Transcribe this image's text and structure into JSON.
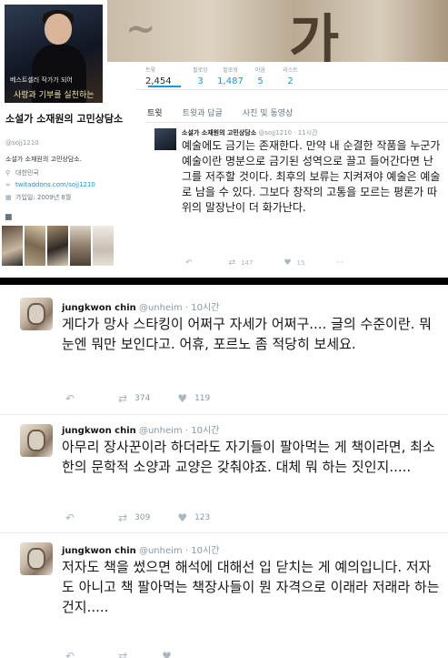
{
  "profile": {
    "banner_text": "가",
    "avatar_caption_1": "베스트셀러 작가가 되어",
    "avatar_caption_2": "사랑과 기부를 실천하는",
    "name": "소설가 소재원의 고민상담소",
    "handle": "@sojj1210",
    "bio": "소설가 소재원의 고민상담소.",
    "location": "대한민국",
    "website": "twitaddons.com/sojj1210",
    "joined": "가입일: 2009년 8월"
  },
  "stats": [
    {
      "label": "트윗",
      "value": "2,454"
    },
    {
      "label": "팔로잉",
      "value": "3"
    },
    {
      "label": "팔로워",
      "value": "1,487"
    },
    {
      "label": "마음",
      "value": "5"
    },
    {
      "label": "리스트",
      "value": "2"
    }
  ],
  "tabs": [
    "트윗",
    "트윗과 답글",
    "사진 및 동영상"
  ],
  "top_tweet": {
    "name": "소설가 소재원의 고민상담소",
    "handle": "@sojj1210",
    "time": "11시간",
    "text": "예술에도 금기는 존재한다. 만약 내 순결한 작품을 누군가 예술이란 명분으로 금기된 성역으로 끌고 들어간다면 난 그를 저주할 것이다. 최후의 보류는 지켜져야 예술은 예술로 남을 수 있다. 그보다 창작의 고통을 모르는 평론가 따위의 말장난이 더 화가난다.",
    "retweets": "147",
    "likes": "15"
  },
  "tweets": [
    {
      "name": "jungkwon chin",
      "handle": "@unheim",
      "time": "10시간",
      "text": "게다가 망사 스타킹이 어쩌구 자세가 어쩌구.... 글의 수준이란. 뭐 눈엔 뭐만 보인다고. 어휴, 포르노 좀 적당히 보세요.",
      "retweets": "374",
      "likes": "119"
    },
    {
      "name": "jungkwon chin",
      "handle": "@unheim",
      "time": "10시간",
      "text": "아무리 장사꾼이라 하더라도 자기들이 팔아먹는 게 책이라면, 최소한의 문학적 소양과 교양은 갖춰야죠. 대체 뭐 하는 짓인지.....",
      "retweets": "309",
      "likes": "123"
    },
    {
      "name": "jungkwon chin",
      "handle": "@unheim",
      "time": "10시간",
      "text": "저자도 책을 썼으면 해석에 대해선 입 닫치는 게 예의입니다. 저자도 아니고 책 팔아먹는 책장사들이 뭔 자격으로 이래라 저래라 하는 건지.....",
      "retweets": "",
      "likes": ""
    }
  ],
  "icons": {
    "reply": "reply-icon",
    "retweet": "retweet-icon",
    "like": "heart-icon",
    "location": "location-pin-icon",
    "link": "link-icon",
    "calendar": "calendar-icon",
    "camera": "camera-icon"
  },
  "colors": {
    "link_blue": "#1b95e0",
    "gray_text": "#8899a6",
    "separator": "#000000"
  }
}
